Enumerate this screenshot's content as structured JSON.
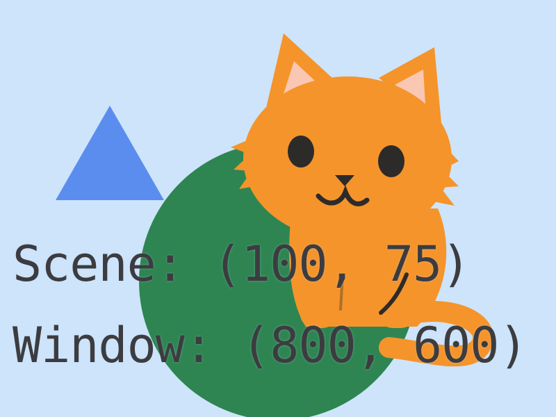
{
  "window": {
    "background_color": "#cde4fb"
  },
  "scene": {
    "triangle": {
      "color": "#5b8def",
      "icon": "triangle-shape"
    },
    "circle": {
      "color": "#2e8552",
      "icon": "circle-shape"
    },
    "cat": {
      "icon": "cat-sprite",
      "fur_color": "#f5942a",
      "ear_inner_color": "#fac7b3",
      "feature_color": "#2d2a2a"
    }
  },
  "hud": {
    "scene_text": "Scene: (100, 75)",
    "window_text": "Window: (800, 600)",
    "text_color": "#3c3c40"
  }
}
